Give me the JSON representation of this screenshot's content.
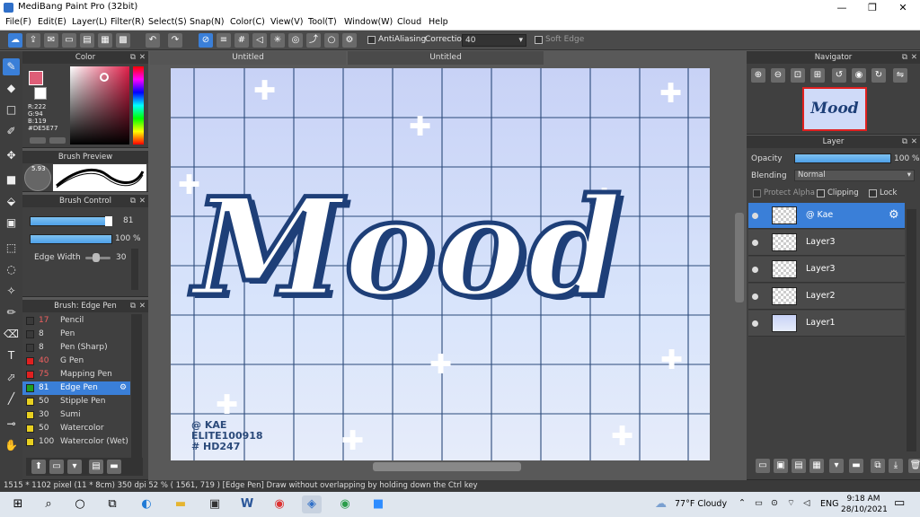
{
  "title": "MediBang Paint Pro (32bit)",
  "window_controls": {
    "minimize": "—",
    "restore": "❐",
    "close": "✕"
  },
  "menu": [
    "File(F)",
    "Edit(E)",
    "Layer(L)",
    "Filter(R)",
    "Select(S)",
    "Snap(N)",
    "Color(C)",
    "View(V)",
    "Tool(T)",
    "Window(W)",
    "Cloud",
    "Help"
  ],
  "toolbar": {
    "antialiasing": "AntiAliasing",
    "correction_label": "Correction",
    "correction_value": "40",
    "soft_edge": "Soft Edge"
  },
  "color_panel": {
    "title": "Color",
    "r": "R:222",
    "g": "G:94",
    "b": "B:119",
    "hex": "#DE5E77",
    "primary": "#de5e77"
  },
  "brush_preview": {
    "title": "Brush Preview",
    "size": "5.93"
  },
  "brush_control": {
    "title": "Brush Control",
    "size_value": "81",
    "opacity_value": "100 %",
    "edge_width_label": "Edge Width",
    "edge_width_value": "30"
  },
  "brush_panel": {
    "title": "Brush: Edge Pen",
    "items": [
      {
        "size": "17",
        "name": "Pencil",
        "color": "#3a3a3a",
        "red": true
      },
      {
        "size": "8",
        "name": "Pen",
        "color": "#3a3a3a",
        "red": false
      },
      {
        "size": "8",
        "name": "Pen (Sharp)",
        "color": "#3a3a3a",
        "red": false
      },
      {
        "size": "40",
        "name": "G Pen",
        "color": "#e02020",
        "red": true
      },
      {
        "size": "75",
        "name": "Mapping Pen",
        "color": "#e02020",
        "red": true
      },
      {
        "size": "81",
        "name": "Edge Pen",
        "color": "#20a020",
        "red": true
      },
      {
        "size": "50",
        "name": "Stipple Pen",
        "color": "#e8d020",
        "red": false
      },
      {
        "size": "30",
        "name": "Sumi",
        "color": "#e8d020",
        "red": false
      },
      {
        "size": "50",
        "name": "Watercolor",
        "color": "#e8d020",
        "red": false
      },
      {
        "size": "100",
        "name": "Watercolor (Wet)",
        "color": "#e8d020",
        "red": false
      }
    ]
  },
  "doc_tabs": [
    "Untitled",
    "Untitled"
  ],
  "canvas_text": {
    "mood": "Mood",
    "credit1": "@ KAE",
    "credit2": "ELITE100918",
    "credit3": "# HD247"
  },
  "navigator": {
    "title": "Navigator",
    "thumb_text": "Mood"
  },
  "layer_panel": {
    "title": "Layer",
    "opacity_label": "Opacity",
    "opacity_value": "100 %",
    "blending_label": "Blending",
    "blending_value": "Normal",
    "protect_alpha": "Protect Alpha",
    "clipping": "Clipping",
    "lock": "Lock",
    "layers": [
      {
        "name": "@ Kae",
        "selected": true
      },
      {
        "name": "Layer3",
        "selected": false
      },
      {
        "name": "Layer3",
        "selected": false
      },
      {
        "name": "Layer2",
        "selected": false
      },
      {
        "name": "Layer1",
        "selected": false
      }
    ]
  },
  "status": "1515 * 1102 pixel   (11 * 8cm)   350 dpi   52 %   ( 1561, 719 )   [Edge Pen] Draw without overlapping by holding down the Ctrl key",
  "taskbar": {
    "weather": "77°F  Cloudy",
    "lang": "ENG",
    "time": "9:18 AM",
    "date": "28/10/2021"
  }
}
